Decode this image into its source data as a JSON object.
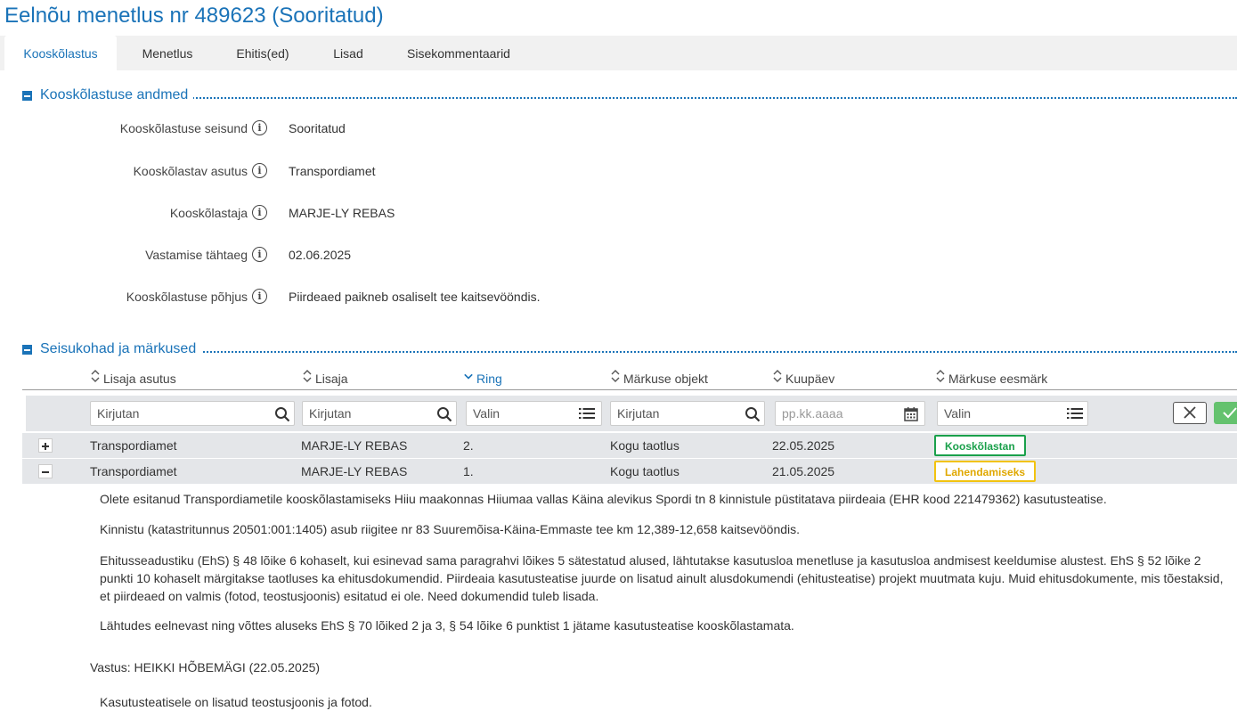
{
  "page": {
    "title": "Eelnõu menetlus nr 489623 (Sooritatud)"
  },
  "tabs": [
    {
      "label": "Kooskõlastus",
      "active": true
    },
    {
      "label": "Menetlus"
    },
    {
      "label": "Ehitis(ed)"
    },
    {
      "label": "Lisad"
    },
    {
      "label": "Sisekommentaarid"
    }
  ],
  "section1": {
    "title": "Kooskõlastuse andmed",
    "fields": [
      {
        "label": "Kooskõlastuse seisund",
        "value": "Sooritatud"
      },
      {
        "label": "Kooskõlastav asutus",
        "value": "Transpordiamet"
      },
      {
        "label": "Kooskõlastaja",
        "value": "MARJE-LY REBAS"
      },
      {
        "label": "Vastamise tähtaeg",
        "value": "02.06.2025"
      },
      {
        "label": "Kooskõlastuse põhjus",
        "value": "Piirdeaed paikneb osaliselt tee kaitsevööndis."
      }
    ]
  },
  "section2": {
    "title": "Seisukohad ja märkused",
    "columns": [
      "Lisaja asutus",
      "Lisaja",
      "Ring",
      "Märkuse objekt",
      "Kuupäev",
      "Märkuse eesmärk"
    ],
    "sorted_column": "Ring",
    "filters": {
      "asutus_placeholder": "Kirjutan",
      "lisaja_placeholder": "Kirjutan",
      "ring_placeholder": "Valin",
      "objekt_placeholder": "Kirjutan",
      "kuupaev_placeholder": "pp.kk.aaaa",
      "eesmark_placeholder": "Valin"
    },
    "rows": [
      {
        "asutus": "Transpordiamet",
        "lisaja": "MARJE-LY REBAS",
        "ring": "2.",
        "objekt": "Kogu taotlus",
        "kuupaev": "22.05.2025",
        "eesmark": "Kooskõlastan",
        "eesmark_color": "#1aa04b",
        "expanded": false
      },
      {
        "asutus": "Transpordiamet",
        "lisaja": "MARJE-LY REBAS",
        "ring": "1.",
        "objekt": "Kogu taotlus",
        "kuupaev": "21.05.2025",
        "eesmark": "Lahendamiseks",
        "eesmark_color": "#f2c30f",
        "expanded": true
      }
    ],
    "expanded_text": [
      "Olete esitanud Transpordiametile kooskõlastamiseks Hiiu maakonnas Hiiumaa vallas Käina alevikus Spordi tn 8 kinnistule püstitatava piirdeaia (EHR kood 221479362) kasutusteatise.",
      "Kinnistu (katastritunnus 20501:001:1405) asub riigitee nr 83 Suuremõisa-Käina-Emmaste tee km 12,389-12,658 kaitsevööndis.",
      "Ehitusseadustiku (EhS) § 48 lõike 6 kohaselt, kui esinevad sama paragrahvi lõikes 5 sätestatud alused, lähtutakse kasutusloa menetluse ja kasutusloa andmisest keeldumise alustest. EhS § 52 lõike 2 punkti 10 kohaselt märgitakse taotluses ka ehitusdokumendid. Piirdeaia kasutusteatise juurde on lisatud ainult alusdokumendi (ehitusteatise) projekt muutmata kuju. Muid ehitusdokumente, mis tõestaksid, et piirdeaed on valmis (fotod, teostusjoonis) esitatud ei ole. Need dokumendid tuleb lisada.",
      "Lähtudes eelnevast ning võttes aluseks EhS § 70 lõiked 2 ja 3, § 54 lõike 6 punktist 1 jätame kasutusteatise kooskõlastamata."
    ],
    "answer_label": "Vastus: HEIKKI HÕBEMÄGI (22.05.2025)",
    "answer_text": "Kasutusteatisele on lisatud teostusjoonis ja fotod."
  },
  "icons": {
    "info": "info-circle-icon",
    "search": "search-icon",
    "list": "list-icon",
    "calendar": "calendar-icon",
    "close": "close-icon",
    "check": "check-icon",
    "sort": "sort-icon",
    "sort_desc": "chevron-down-icon"
  }
}
